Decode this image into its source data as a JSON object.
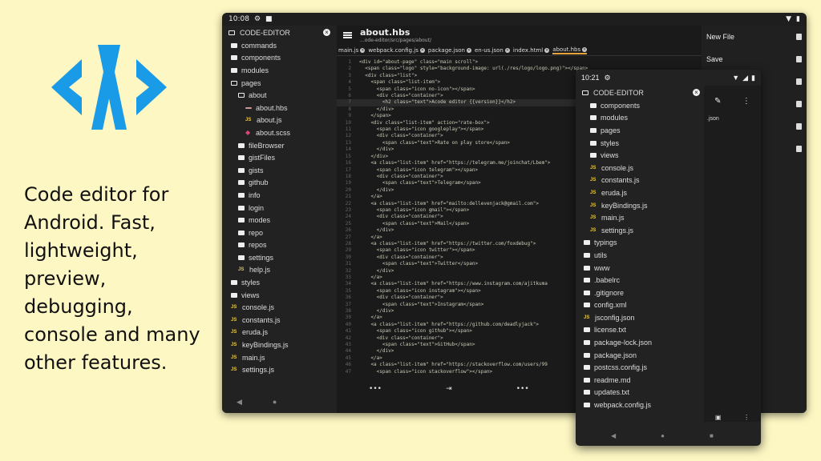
{
  "promo": {
    "text": "Code editor for Android. Fast, lightweight, preview, debugging, console and many other features."
  },
  "tablet": {
    "status_time": "10:08",
    "drawer": {
      "title": "CODE-EDITOR",
      "items": [
        {
          "label": "commands",
          "type": "folder",
          "depth": 1
        },
        {
          "label": "components",
          "type": "folder",
          "depth": 1
        },
        {
          "label": "modules",
          "type": "folder",
          "depth": 1
        },
        {
          "label": "pages",
          "type": "folder-open",
          "depth": 1
        },
        {
          "label": "about",
          "type": "folder-open",
          "depth": 2
        },
        {
          "label": "about.hbs",
          "type": "hbs",
          "depth": 3
        },
        {
          "label": "about.js",
          "type": "js",
          "depth": 3
        },
        {
          "label": "about.scss",
          "type": "scss",
          "depth": 3
        },
        {
          "label": "fileBrowser",
          "type": "folder",
          "depth": 2
        },
        {
          "label": "gistFiles",
          "type": "folder",
          "depth": 2
        },
        {
          "label": "gists",
          "type": "folder",
          "depth": 2
        },
        {
          "label": "github",
          "type": "folder",
          "depth": 2
        },
        {
          "label": "info",
          "type": "folder",
          "depth": 2
        },
        {
          "label": "login",
          "type": "folder",
          "depth": 2
        },
        {
          "label": "modes",
          "type": "folder",
          "depth": 2
        },
        {
          "label": "repo",
          "type": "folder",
          "depth": 2
        },
        {
          "label": "repos",
          "type": "folder",
          "depth": 2
        },
        {
          "label": "settings",
          "type": "folder",
          "depth": 2
        },
        {
          "label": "help.js",
          "type": "js",
          "depth": 2
        },
        {
          "label": "styles",
          "type": "folder",
          "depth": 1
        },
        {
          "label": "views",
          "type": "folder",
          "depth": 1
        },
        {
          "label": "console.js",
          "type": "js",
          "depth": 1
        },
        {
          "label": "constants.js",
          "type": "js",
          "depth": 1
        },
        {
          "label": "eruda.js",
          "type": "js",
          "depth": 1
        },
        {
          "label": "keyBindings.js",
          "type": "js",
          "depth": 1
        },
        {
          "label": "main.js",
          "type": "js",
          "depth": 1
        },
        {
          "label": "settings.js",
          "type": "js",
          "depth": 1
        }
      ]
    },
    "editor": {
      "title": "about.hbs",
      "path": "...ode-editor/src/pages/about/",
      "tabs": [
        "main.js",
        "webpack.config.js",
        "package.json",
        "en-us.json",
        "index.html",
        "about.hbs"
      ],
      "lines": [
        {
          "n": "1",
          "code": "<div id=\"about-page\" class=\"main scroll\">"
        },
        {
          "n": "2",
          "code": "  <span class=\"logo\" style=\"background-image: url(./res/logo/logo.png)\"></span>"
        },
        {
          "n": "3",
          "code": "  <div class=\"list\">"
        },
        {
          "n": "4",
          "code": "    <span class=\"list-item\">"
        },
        {
          "n": "5",
          "code": "      <span class=\"icon no-icon\"></span>"
        },
        {
          "n": "6",
          "code": "      <div class=\"container\">"
        },
        {
          "n": "7",
          "code": "        <h2 class=\"text\">Acode editor {{version}}</h2>"
        },
        {
          "n": "8",
          "code": "      </div>"
        },
        {
          "n": "9",
          "code": "    </span>"
        },
        {
          "n": "10",
          "code": "    <div class=\"list-item\" action=\"rate-box\">"
        },
        {
          "n": "11",
          "code": "      <span class=\"icon googleplay\"></span>"
        },
        {
          "n": "12",
          "code": "      <div class=\"container\">"
        },
        {
          "n": "13",
          "code": "        <span class=\"text\">Rate on play store</span>"
        },
        {
          "n": "14",
          "code": "      </div>"
        },
        {
          "n": "15",
          "code": "    </div>"
        },
        {
          "n": "16",
          "code": "    <a class=\"list-item\" href=\"https://telegram.me/joinchat/Lbem\">"
        },
        {
          "n": "17",
          "code": "      <span class=\"icon telegram\"></span>"
        },
        {
          "n": "18",
          "code": "      <div class=\"container\">"
        },
        {
          "n": "19",
          "code": "        <span class=\"text\">Telegram</span>"
        },
        {
          "n": "20",
          "code": "      </div>"
        },
        {
          "n": "21",
          "code": "    </a>"
        },
        {
          "n": "22",
          "code": "    <a class=\"list-item\" href=\"mailto:dellevenjack@gmail.com\">"
        },
        {
          "n": "23",
          "code": "      <span class=\"icon gmail\"></span>"
        },
        {
          "n": "24",
          "code": "      <div class=\"container\">"
        },
        {
          "n": "25",
          "code": "        <span class=\"text\">Mail</span>"
        },
        {
          "n": "26",
          "code": "      </div>"
        },
        {
          "n": "27",
          "code": "    </a>"
        },
        {
          "n": "28",
          "code": "    <a class=\"list-item\" href=\"https://twitter.com/foxdebug\">"
        },
        {
          "n": "29",
          "code": "      <span class=\"icon twitter\"></span>"
        },
        {
          "n": "30",
          "code": "      <div class=\"container\">"
        },
        {
          "n": "31",
          "code": "        <span class=\"text\">Twitter</span>"
        },
        {
          "n": "32",
          "code": "      </div>"
        },
        {
          "n": "33",
          "code": "    </a>"
        },
        {
          "n": "34",
          "code": "    <a class=\"list-item\" href=\"https://www.instagram.com/ajitkuma"
        },
        {
          "n": "35",
          "code": "      <span class=\"icon instagram\"></span>"
        },
        {
          "n": "36",
          "code": "      <div class=\"container\">"
        },
        {
          "n": "37",
          "code": "        <span class=\"text\">Instagram</span>"
        },
        {
          "n": "38",
          "code": "      </div>"
        },
        {
          "n": "39",
          "code": "    </a>"
        },
        {
          "n": "40",
          "code": "    <a class=\"list-item\" href=\"https://github.com/deadlyjack\">"
        },
        {
          "n": "41",
          "code": "      <span class=\"icon github\"></span>"
        },
        {
          "n": "42",
          "code": "      <div class=\"container\">"
        },
        {
          "n": "43",
          "code": "        <span class=\"text\">GitHub</span>"
        },
        {
          "n": "44",
          "code": "      </div>"
        },
        {
          "n": "45",
          "code": "    </a>"
        },
        {
          "n": "46",
          "code": "    <a class=\"list-item\" href=\"https://stackoverflow.com/users/99"
        },
        {
          "n": "47",
          "code": "      <span class=\"icon stackoverflow\"></span>"
        }
      ],
      "keybar": [
        "•••",
        "⇥",
        "•••",
        "↶",
        "↷"
      ]
    },
    "menu": [
      {
        "label": "New File"
      },
      {
        "label": "Save"
      }
    ]
  },
  "phone": {
    "status_time": "10:21",
    "drawer": {
      "title": "CODE-EDITOR",
      "items": [
        {
          "label": "components",
          "type": "folder"
        },
        {
          "label": "modules",
          "type": "folder"
        },
        {
          "label": "pages",
          "type": "folder"
        },
        {
          "label": "styles",
          "type": "folder"
        },
        {
          "label": "views",
          "type": "folder"
        },
        {
          "label": "console.js",
          "type": "js"
        },
        {
          "label": "constants.js",
          "type": "js"
        },
        {
          "label": "eruda.js",
          "type": "js"
        },
        {
          "label": "keyBindings.js",
          "type": "js"
        },
        {
          "label": "main.js",
          "type": "js"
        },
        {
          "label": "settings.js",
          "type": "js"
        },
        {
          "label": "typings",
          "type": "folder",
          "top": true
        },
        {
          "label": "utils",
          "type": "folder",
          "top": true
        },
        {
          "label": "www",
          "type": "folder",
          "top": true
        },
        {
          "label": ".babelrc",
          "type": "file",
          "top": true
        },
        {
          "label": ".gitignore",
          "type": "file",
          "top": true
        },
        {
          "label": "config.xml",
          "type": "file",
          "top": true
        },
        {
          "label": "jsconfig.json",
          "type": "js",
          "top": true
        },
        {
          "label": "license.txt",
          "type": "file",
          "top": true
        },
        {
          "label": "package-lock.json",
          "type": "file",
          "top": true
        },
        {
          "label": "package.json",
          "type": "file",
          "top": true
        },
        {
          "label": "postcss.config.js",
          "type": "file",
          "top": true
        },
        {
          "label": "readme.md",
          "type": "file",
          "top": true
        },
        {
          "label": "updates.txt",
          "type": "file",
          "top": true
        },
        {
          "label": "webpack.config.js",
          "type": "file",
          "top": true
        }
      ]
    },
    "peek_tab": ".json"
  }
}
